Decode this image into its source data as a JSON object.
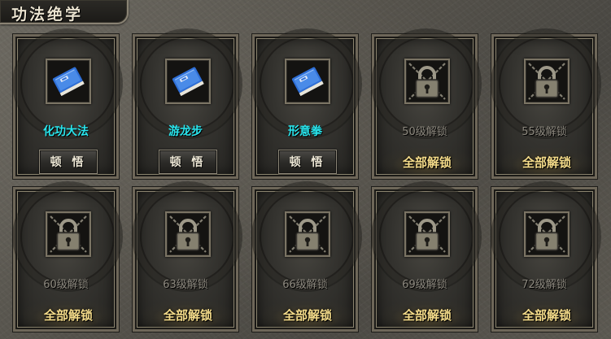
{
  "panel": {
    "title": "功法绝学"
  },
  "learned_action_label": "顿 悟",
  "unlock_all_label": "全部解锁",
  "skills": [
    {
      "name": "化功大法",
      "state": "learned",
      "icon": "blue-book-icon"
    },
    {
      "name": "游龙步",
      "state": "learned",
      "icon": "blue-book-icon"
    },
    {
      "name": "形意拳",
      "state": "learned",
      "icon": "blue-book-icon"
    },
    {
      "name": "50级解锁",
      "state": "locked",
      "icon": "chained-lock-icon"
    },
    {
      "name": "55级解锁",
      "state": "locked",
      "icon": "chained-lock-icon"
    },
    {
      "name": "60级解锁",
      "state": "locked",
      "icon": "chained-lock-icon"
    },
    {
      "name": "63级解锁",
      "state": "locked",
      "icon": "chained-lock-icon"
    },
    {
      "name": "66级解锁",
      "state": "locked",
      "icon": "chained-lock-icon"
    },
    {
      "name": "69级解锁",
      "state": "locked",
      "icon": "chained-lock-icon"
    },
    {
      "name": "72级解锁",
      "state": "locked",
      "icon": "chained-lock-icon"
    }
  ],
  "colors": {
    "learned_name": "#29e6ee",
    "locked_name": "#8c887e",
    "unlock_label": "#f5dc8a"
  }
}
